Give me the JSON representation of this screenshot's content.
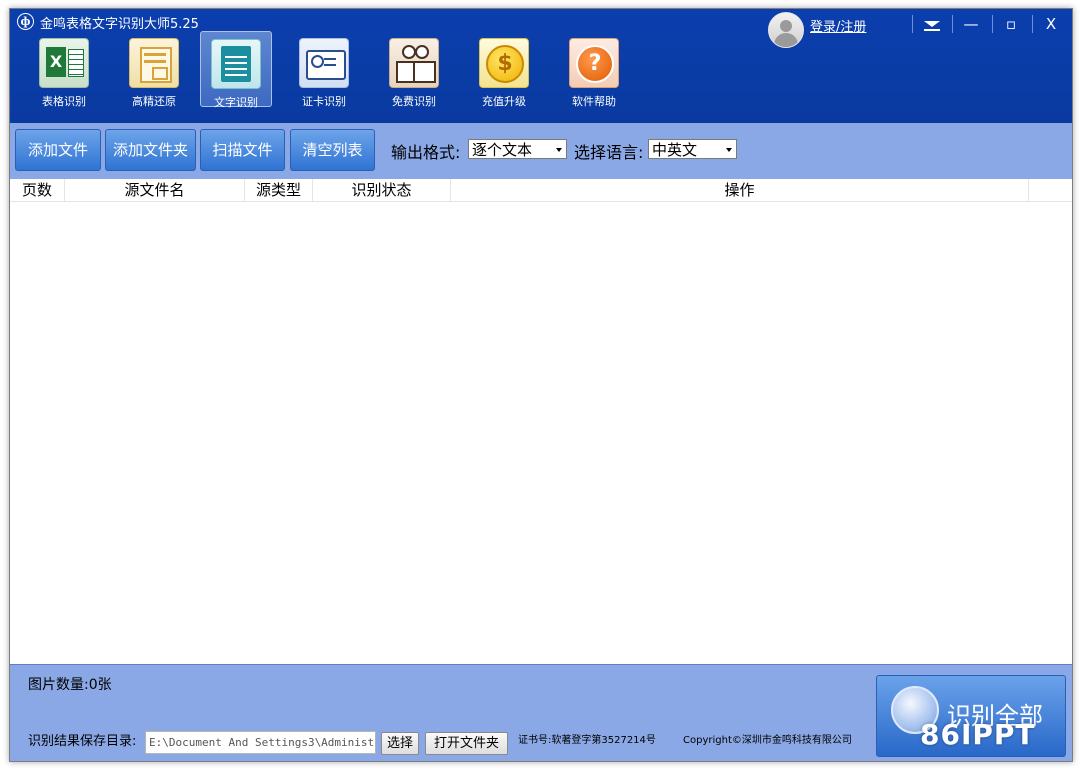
{
  "app": {
    "title": "金鸣表格文字识别大师5.25",
    "logo_glyph": "ф"
  },
  "toolbar": {
    "tools": [
      {
        "label": "表格识别",
        "icon": "excel-icon"
      },
      {
        "label": "高精还原",
        "icon": "layout-restore-icon"
      },
      {
        "label": "文字识别",
        "icon": "text-document-icon",
        "active": true
      },
      {
        "label": "证卡识别",
        "icon": "id-card-icon"
      },
      {
        "label": "免费识别",
        "icon": "owl-book-icon"
      },
      {
        "label": "充值升级",
        "icon": "coin-icon",
        "glyph": "$"
      },
      {
        "label": "软件帮助",
        "icon": "help-icon",
        "glyph": "?"
      }
    ]
  },
  "account": {
    "login_label": "登录/注册"
  },
  "window_controls": {
    "minimize": "—",
    "maximize": "▫",
    "close": "X"
  },
  "actions": {
    "add_file": "添加文件",
    "add_folder": "添加文件夹",
    "scan_file": "扫描文件",
    "clear_list": "清空列表",
    "output_format_label": "输出格式:",
    "output_format_value": "逐个文本",
    "language_label": "选择语言:",
    "language_value": "中英文"
  },
  "table": {
    "columns": [
      "页数",
      "源文件名",
      "源类型",
      "识别状态",
      "操作"
    ],
    "rows": []
  },
  "footer": {
    "image_count": "图片数量:0张",
    "save_dir_label": "识别结果保存目录:",
    "save_dir_value": "E:\\Document And Settings3\\Administ",
    "choose_button": "选择",
    "open_folder_button": "打开文件夹",
    "cert_text": "证书号:软著登字第3527214号",
    "copyright_text": "Copyright©深圳市金鸣科技有限公司",
    "recognize_all_button": "识别全部"
  },
  "watermark": "86IPPT",
  "colors": {
    "header_blue": "#0b3fae",
    "toolbar_blue": "#8aa8e6",
    "button_blue": "#2f73d2"
  }
}
